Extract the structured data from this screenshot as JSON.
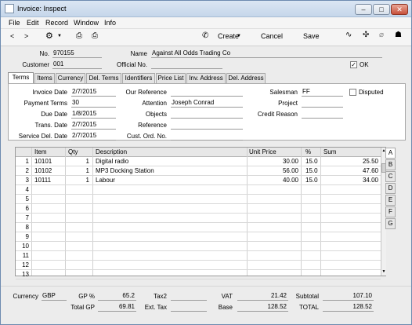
{
  "window": {
    "title": "Invoice: Inspect"
  },
  "menu": [
    "File",
    "Edit",
    "Record",
    "Window",
    "Info"
  ],
  "toolbar": {
    "create": "Create",
    "cancel": "Cancel",
    "save": "Save"
  },
  "header": {
    "no_label": "No.",
    "no_value": "970155",
    "name_label": "Name",
    "name_value": "Against All Odds Trading Co",
    "customer_label": "Customer",
    "customer_value": "001",
    "official_label": "Official No.",
    "official_value": "",
    "ok_label": "OK",
    "ok_checked": true
  },
  "tabs": [
    "Terms",
    "Items",
    "Currency",
    "Del. Terms",
    "Identifiers",
    "Price List",
    "Inv. Address",
    "Del. Address"
  ],
  "terms": {
    "invoice_date_label": "Invoice Date",
    "invoice_date": "2/7/2015",
    "payment_terms_label": "Payment Terms",
    "payment_terms": "30",
    "due_date_label": "Due Date",
    "due_date": "1/8/2015",
    "trans_date_label": "Trans. Date",
    "trans_date": "2/7/2015",
    "service_date_label": "Service Del. Date",
    "service_date": "2/7/2015",
    "our_ref_label": "Our Reference",
    "our_ref": "",
    "attention_label": "Attention",
    "attention": "Joseph Conrad",
    "objects_label": "Objects",
    "objects": "",
    "reference_label": "Reference",
    "reference": "",
    "cust_ord_label": "Cust. Ord. No.",
    "cust_ord": "",
    "salesman_label": "Salesman",
    "salesman": "FF",
    "project_label": "Project",
    "project": "",
    "credit_reason_label": "Credit Reason",
    "credit_reason": "",
    "disputed_label": "Disputed"
  },
  "grid": {
    "headers": [
      "Item",
      "Qty",
      "Description",
      "Unit Price",
      "%",
      "Sum"
    ],
    "rows": [
      {
        "n": "1",
        "item": "10101",
        "qty": "1",
        "desc": "Digital radio",
        "price": "30.00",
        "pct": "15.0",
        "sum": "25.50"
      },
      {
        "n": "2",
        "item": "10102",
        "qty": "1",
        "desc": "MP3 Docking Station",
        "price": "56.00",
        "pct": "15.0",
        "sum": "47.60"
      },
      {
        "n": "3",
        "item": "10111",
        "qty": "1",
        "desc": "Labour",
        "price": "40.00",
        "pct": "15.0",
        "sum": "34.00"
      },
      {
        "n": "4"
      },
      {
        "n": "5"
      },
      {
        "n": "6"
      },
      {
        "n": "7"
      },
      {
        "n": "8"
      },
      {
        "n": "9"
      },
      {
        "n": "10"
      },
      {
        "n": "11"
      },
      {
        "n": "12"
      },
      {
        "n": "13"
      }
    ],
    "side_tabs": [
      "A",
      "B",
      "C",
      "D",
      "E",
      "F",
      "G"
    ]
  },
  "footer": {
    "currency_label": "Currency",
    "currency": "GBP",
    "gp_pct_label": "GP %",
    "gp_pct": "65.2",
    "total_gp_label": "Total GP",
    "total_gp": "69.81",
    "tax2_label": "Tax2",
    "tax2": "",
    "ext_tax_label": "Ext. Tax",
    "ext_tax": "",
    "vat_label": "VAT",
    "vat": "21.42",
    "base_label": "Base",
    "base": "128.52",
    "subtotal_label": "Subtotal",
    "subtotal": "107.10",
    "total_label": "TOTAL",
    "total": "128.52"
  }
}
